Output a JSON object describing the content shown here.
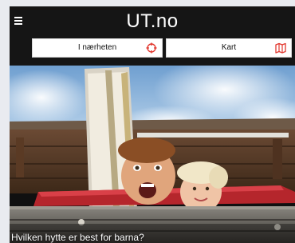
{
  "app": {
    "title": "UT.no"
  },
  "actions": {
    "nearby_label": "I nærheten",
    "nearby_icon": "crosshair-icon",
    "map_label": "Kart",
    "map_icon": "map-icon",
    "icon_color": "#e2382f"
  },
  "hero": {
    "caption": "Hvilken hytte er best for barna?"
  }
}
